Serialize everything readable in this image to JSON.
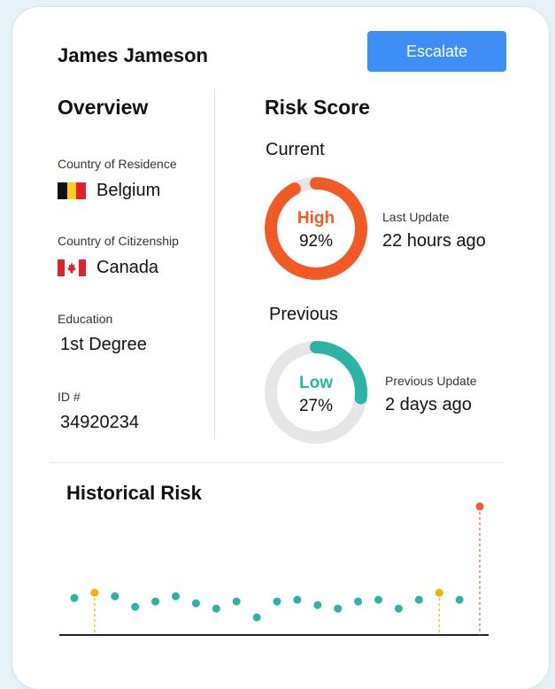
{
  "header": {
    "name": "James Jameson",
    "escalate_label": "Escalate"
  },
  "overview": {
    "title": "Overview",
    "residence_label": "Country of Residence",
    "residence_value": "Belgium",
    "citizenship_label": "Country of Citizenship",
    "citizenship_value": "Canada",
    "education_label": "Education",
    "education_value": "1st Degree",
    "id_label": "ID #",
    "id_value": "34920234"
  },
  "risk": {
    "title": "Risk Score",
    "current": {
      "heading": "Current",
      "level": "High",
      "percent": 92,
      "percent_text": "92%",
      "color": "#f15a24",
      "update_label": "Last Update",
      "update_value": "22 hours ago"
    },
    "previous": {
      "heading": "Previous",
      "level": "Low",
      "percent": 27,
      "percent_text": "27%",
      "color": "#2bb4a6",
      "update_label": "Previous Update",
      "update_value": "2 days ago"
    }
  },
  "colors": {
    "accent": "#3d8ef7",
    "high": "#f15a24",
    "low": "#2bb4a6",
    "warn": "#f6b100",
    "track": "#e6e6e6"
  },
  "chart_data": {
    "type": "scatter",
    "title": "Historical Risk",
    "x": [
      1,
      2,
      3,
      4,
      5,
      6,
      7,
      8,
      9,
      10,
      11,
      12,
      13,
      14,
      15,
      16,
      17,
      18,
      19,
      20,
      21,
      22
    ],
    "y": [
      21,
      24,
      22,
      16,
      19,
      22,
      18,
      15,
      19,
      10,
      19,
      20,
      17,
      15,
      19,
      20,
      15,
      20,
      24,
      20,
      73
    ],
    "x_full": [
      1,
      2,
      3,
      4,
      5,
      6,
      7,
      8,
      9,
      10,
      11,
      12,
      13,
      14,
      15,
      16,
      17,
      18,
      19,
      20,
      21,
      22
    ],
    "y_full": [
      21,
      24,
      22,
      16,
      19,
      22,
      18,
      15,
      19,
      10,
      19,
      20,
      17,
      15,
      19,
      20,
      15,
      20,
      24,
      20,
      73
    ],
    "levels": [
      "low",
      "medium",
      "low",
      "low",
      "low",
      "low",
      "low",
      "low",
      "low",
      "low",
      "low",
      "low",
      "low",
      "low",
      "low",
      "low",
      "low",
      "low",
      "medium",
      "low",
      "high"
    ],
    "ylim": [
      0,
      80
    ],
    "grid": false
  }
}
